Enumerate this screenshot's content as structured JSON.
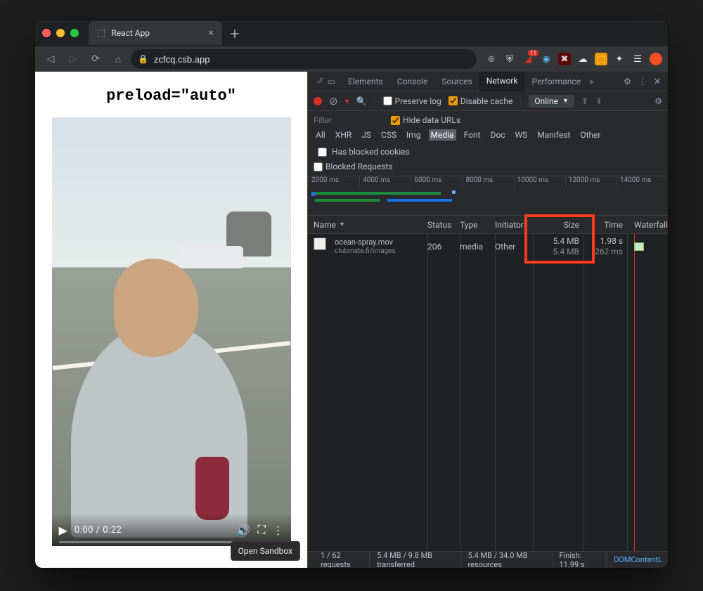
{
  "browser": {
    "tab_title": "React App",
    "url": "zcfcq.csb.app"
  },
  "page": {
    "heading": "preload=\"auto\"",
    "video": {
      "current_time": "0:00",
      "duration": "0:22"
    },
    "open_sandbox": "Open Sandbox"
  },
  "devtools": {
    "tabs": [
      "Elements",
      "Console",
      "Sources",
      "Network",
      "Performance"
    ],
    "active_tab": "Network",
    "toolbar": {
      "preserve_log": "Preserve log",
      "disable_cache": "Disable cache",
      "throttling": "Online"
    },
    "filter": {
      "placeholder": "Filter",
      "hide_data_urls": "Hide data URLs",
      "types": [
        "All",
        "XHR",
        "JS",
        "CSS",
        "Img",
        "Media",
        "Font",
        "Doc",
        "WS",
        "Manifest",
        "Other"
      ],
      "active_type": "Media",
      "has_blocked_cookies": "Has blocked cookies",
      "blocked_requests": "Blocked Requests"
    },
    "timeline": {
      "marks": [
        "2000 ms",
        "4000 ms",
        "6000 ms",
        "8000 ms",
        "10000 ms",
        "12000 ms",
        "14000 ms"
      ]
    },
    "columns": {
      "name": "Name",
      "status": "Status",
      "type": "Type",
      "initiator": "Initiator",
      "size": "Size",
      "time": "Time",
      "waterfall": "Waterfall"
    },
    "rows": [
      {
        "name": "ocean-spray.mov",
        "subtitle": "clubmate.fi/images",
        "status": "206",
        "type": "media",
        "initiator": "Other",
        "size": "5.4 MB",
        "size2": "5.4 MB",
        "time": "1.98 s",
        "time2": "262 ms"
      }
    ],
    "statusbar": {
      "requests": "1 / 62 requests",
      "transferred": "5.4 MB / 9.8 MB transferred",
      "resources": "5.4 MB / 34.0 MB resources",
      "finish": "Finish: 11.99 s",
      "dom": "DOMContentL"
    }
  }
}
